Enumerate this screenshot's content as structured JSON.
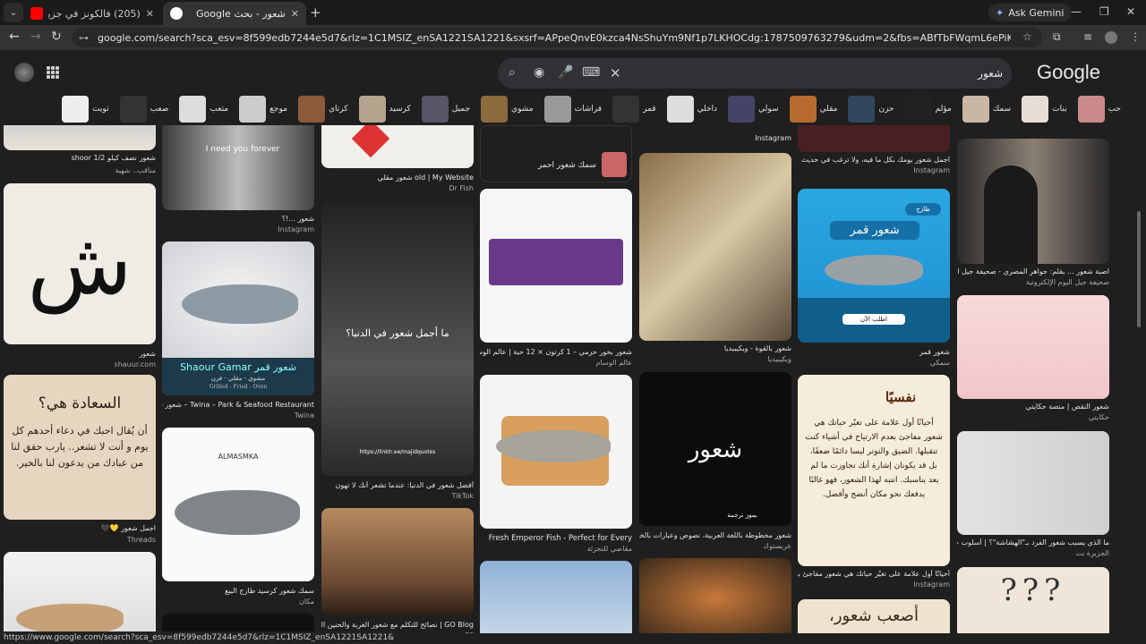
{
  "tabs": [
    {
      "title": "(205) فالكونز في جزيرة بـ2000 ريال",
      "active": false,
      "favicon_color": "#ff0000"
    },
    {
      "title": "شعور - بحث Google",
      "active": true,
      "favicon_color": "#ffffff"
    }
  ],
  "ask_gemini": "Ask Gemini",
  "url": "google.com/search?sca_esv=8f599edb7244e5d7&rlz=1C1MSIZ_enSA1221SA1221&sxsrf=APpeQnvE0kzca4NsShuYm9Nf1p7LKHOCdg:1787509763279&udm=2&fbs=ABfTbFWqmL6ePiKu6ftcYhRaGU-Yi4aRdEdQF3yxspZg9kZO0u1riZuC2kVHM2UiUkK...",
  "search": {
    "query": "شعور"
  },
  "google_logo": "Google",
  "chips": [
    "حب",
    "بنات",
    "سمك",
    "مؤلم",
    "حزن",
    "مقلي",
    "سولي",
    "داخلي",
    "قمر",
    "فراشات",
    "مشوي",
    "جميل",
    "كرسيد",
    "كرتاي",
    "موجع",
    "متعب",
    "صعب",
    "تويت"
  ],
  "chip_colors": [
    "#c98a8a",
    "#e6ddd8",
    "#c9b7a4",
    "#222",
    "#30475e",
    "#b86b2e",
    "#446",
    "#ddd",
    "#333",
    "#999",
    "#8b6a3b",
    "#556",
    "#b5a48e",
    "#8a5a3a",
    "#ccc",
    "#ddd",
    "#333",
    "#eee"
  ],
  "cards": [
    {
      "caption": "شعور نصف كيلو 1/2 shoor",
      "source": "مناقب.. شهية"
    },
    {
      "caption": "شعور",
      "source": "shauur.com"
    },
    {
      "caption": "اجمل شعور 💛🖤",
      "source": "Threads"
    },
    {
      "caption": "شعور ...!؟",
      "source": "Instagram"
    },
    {
      "caption": "Twina – Park & Seafood Restaurant – شعور قمر",
      "source": "Twina"
    },
    {
      "caption": "سمك شعور كرسيد طازج البيع",
      "source": "مكان"
    },
    {
      "caption": "old | My Website شعور مقلي",
      "source": "Dr Fish"
    },
    {
      "caption": "أفضل شعور في الدنيا: عندما تشعر أنك لا تهون",
      "source": "TikTok"
    },
    {
      "caption": "GO Blog | نصائح للتكلم مع شعور الغربة والحنين الوطن",
      "source": "EF"
    },
    {
      "caption": "سمك شعور احمر",
      "source": ""
    },
    {
      "caption": "شعور بخور حرمي – 1 كرتون × 12 حبة | عالم الوسام",
      "source": "عالم الوسام"
    },
    {
      "caption": "Fresh Emperor Fish - Perfect for Every",
      "source": "مقاضي للتجزئة"
    },
    {
      "caption": "شعور بالقوة - ويكيبيديا",
      "source": "ويكيبيديا"
    },
    {
      "caption": "شعور مخطوطة باللغة العربية، نصوص وعبارات بالخط الحر",
      "source": "عربستوك"
    },
    {
      "caption": "اجمل شعور يومك بكل ما فيه، ولا ترغب في حديث",
      "source": "Instagram"
    },
    {
      "caption": "شعور قمر",
      "source": "سمكي"
    },
    {
      "caption": "أحيانًا أول علامة على تغيّر حياتك هي شعور مفاجئ بعدم الارتياح",
      "source": "Instagram"
    },
    {
      "caption": "اصبة شعور ... بقلم: جواهر المصري - صحيفة جيل اليوم الإلكترونية",
      "source": "صحيفة جيل اليوم الإلكترونية"
    },
    {
      "caption": "شعور النقص | منصة حكايتي",
      "source": "حكايتي"
    },
    {
      "caption": "ما الذي يسبب شعور الفرد بـ\"الهشاشة\"؟ | أسلوب حياة",
      "source": "الجزيرة نت"
    }
  ],
  "card_texts": {
    "shaour_label": "Shaour Gamar شعور قمر",
    "shaour_sub": "مشوي - مقلي - فرن",
    "shaour_sub2": "Grilled - Fried - Oven",
    "almasmka": "ALMASMKA",
    "sa3ada_title": "السعادة هي؟",
    "sa3ada_body": "أن يُقال احبك في دعاء أحدهم كل يوم و أنت لا تشعر.. يارب حقق لنا من عبادك من يدعون لنا بالخير.",
    "dark_quote": "ما أجمل شعور في الدنيا؟",
    "dark_link": "https://linktr.ee/majidquotes",
    "fish_blue_title": "شعور قمر",
    "fish_blue_btn": "اطلب الآن",
    "fish_blue_badge": "طازج",
    "nafsiyan": "نفسيًا",
    "nafsiyan_body": "أحيانًا أول علامة على تغيّر حياتك هي شعور مفاجئ بعدم الارتياح في أشياء كنت تتقبلها. الضيق والتوتر ليسا دائمًا ضعفًا، بل قد يكونان إشارة أنك تجاوزت ما لم يعد يناسبك. انتبه لهذا الشعور، فهو غالبًا يدفعك نحو مكان أنضج وأفضل.",
    "asaab": "أصعب شعور،",
    "araboo": "شعور",
    "araboo_tag": "بموز ترجمة",
    "need": "I need you forever",
    "insta": "Instagram"
  },
  "status_url": "https://www.google.com/search?sca_esv=8f599edb7244e5d7&rlz=1C1MSIZ_enSA1221SA1221&biw=1920&bih=991..."
}
